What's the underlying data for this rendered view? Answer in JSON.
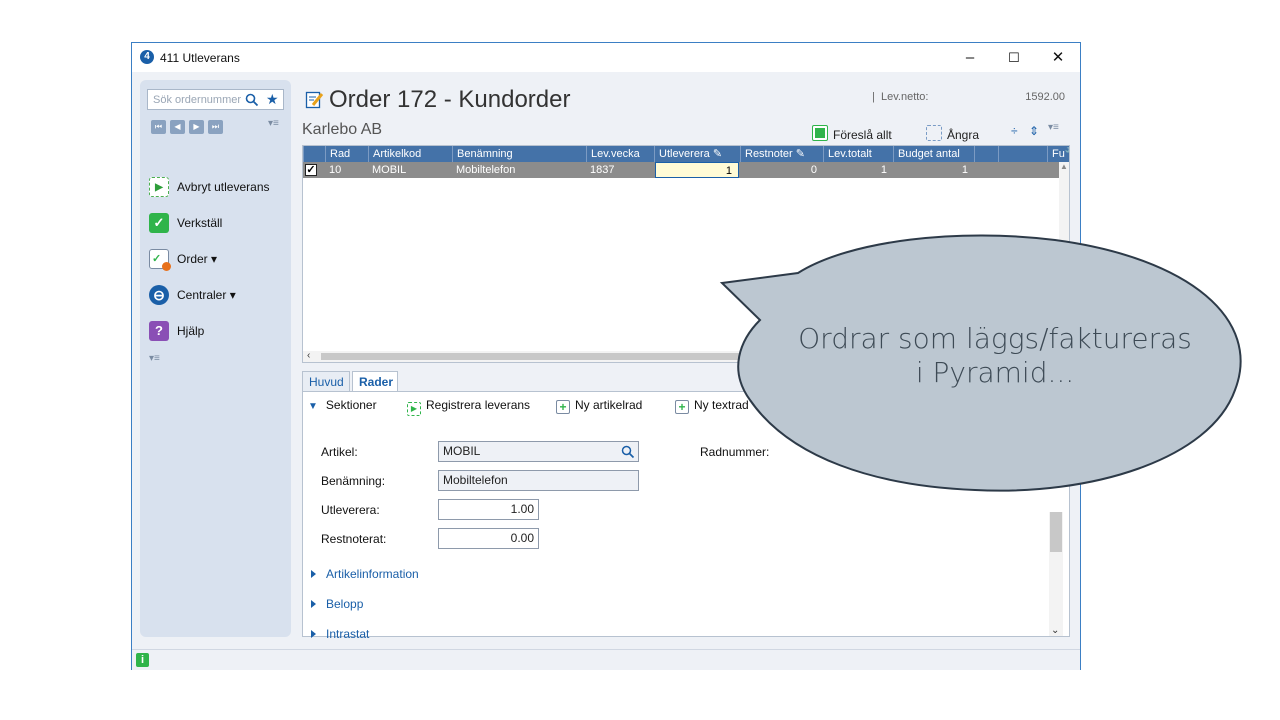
{
  "window": {
    "title": "411 Utleverans",
    "icon": "411",
    "minimize": "–",
    "maximize": "☐",
    "close": "✕"
  },
  "leftpanel": {
    "search_placeholder": "Sök ordernummer",
    "nav": [
      "⏮",
      "◀",
      "▶",
      "⏭"
    ],
    "items": [
      {
        "label": "Avbryt utleverans",
        "icon": "play-icon"
      },
      {
        "label": "Verkställ",
        "icon": "check-icon"
      },
      {
        "label": "Order",
        "icon": "order-icon"
      },
      {
        "label": "Centraler",
        "icon": "central-icon"
      },
      {
        "label": "Hjälp",
        "icon": "help-icon"
      }
    ]
  },
  "header": {
    "order_title": "Order 172 - Kundorder",
    "customer": "Karlebo AB",
    "lev_netto_label": "Lev.netto:",
    "lev_netto_value": "1592.00",
    "suggest_all": "Föreslå allt",
    "undo": "Ångra"
  },
  "grid": {
    "columns": [
      "Rad",
      "Artikelkod",
      "Benämning",
      "Lev.vecka",
      "Utleverera",
      "Restnoter",
      "Lev.totalt",
      "Budget antal",
      "Fu"
    ],
    "rows": [
      {
        "rad": "10",
        "artikelkod": "MOBIL",
        "benamning": "Mobiltelefon",
        "levvecka": "1837",
        "utleverera": "1",
        "restnoter": "0",
        "levtotalt": "1",
        "budget": "1"
      }
    ]
  },
  "tabs": [
    "Huvud",
    "Rader"
  ],
  "detail": {
    "toolbar": [
      "Sektioner",
      "Registrera leverans",
      "Ny artikelrad",
      "Ny textrad"
    ],
    "fields": {
      "artikel_label": "Artikel:",
      "artikel_value": "MOBIL",
      "benamning_label": "Benämning:",
      "benamning_value": "Mobiltelefon",
      "utleverera_label": "Utleverera:",
      "utleverera_value": "1.00",
      "restnoterat_label": "Restnoterat:",
      "restnoterat_value": "0.00",
      "radnummer_label": "Radnummer:"
    },
    "sections": [
      "Artikelinformation",
      "Belopp",
      "Intrastat"
    ]
  },
  "callout": {
    "line1": "Ordrar som läggs/faktureras",
    "line2": "i Pyramid..."
  },
  "colors": {
    "accent": "#1a5fa8",
    "grid_header": "#4472a8",
    "callout_fill": "#bcc7d1",
    "callout_stroke": "#2d3a48"
  }
}
